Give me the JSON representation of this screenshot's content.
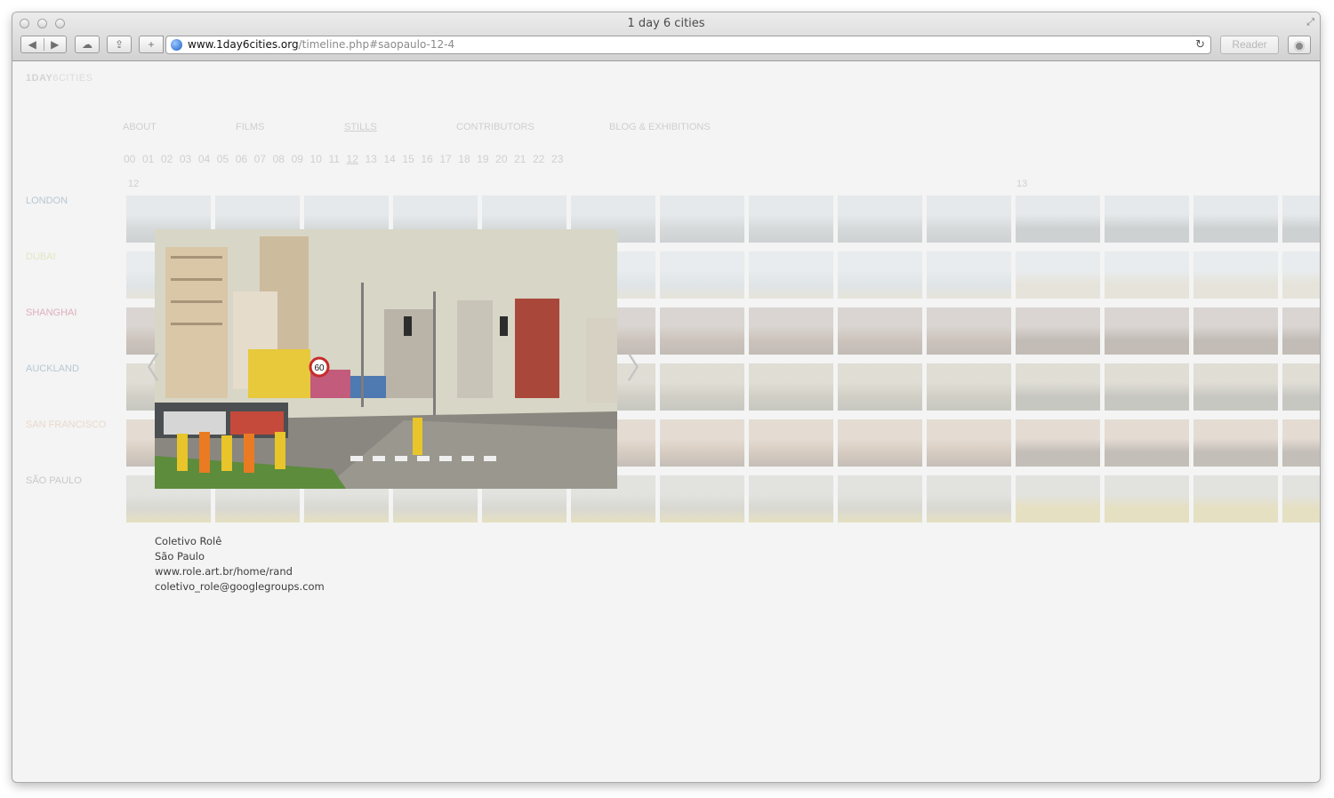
{
  "window": {
    "title": "1 day 6 cities"
  },
  "toolbar": {
    "url_host": "www.1day6cities.org",
    "url_path": "/timeline.php#saopaulo-12-4",
    "reader_label": "Reader"
  },
  "site": {
    "logo_bold": "1DAY",
    "logo_light": "6CITIES",
    "nav": [
      "ABOUT",
      "FILMS",
      "STILLS",
      "CONTRIBUTORS",
      "BLOG & EXHIBITIONS"
    ],
    "hours": [
      "00",
      "01",
      "02",
      "03",
      "04",
      "05",
      "06",
      "07",
      "08",
      "09",
      "10",
      "11",
      "12",
      "13",
      "14",
      "15",
      "16",
      "17",
      "18",
      "19",
      "20",
      "21",
      "22",
      "23"
    ],
    "active_hour": "12",
    "column_hours": [
      "12",
      "13"
    ],
    "cities": [
      {
        "name": "LONDON",
        "color": "#b9c6d6"
      },
      {
        "name": "DUBAI",
        "color": "#e4e6c5"
      },
      {
        "name": "SHANGHAI",
        "color": "#e0aebd"
      },
      {
        "name": "AUCKLAND",
        "color": "#b8c7d6"
      },
      {
        "name": "SAN FRANCISCO",
        "color": "#ead8cc"
      },
      {
        "name": "SÃO PAULO",
        "color": "#c8c8c8"
      }
    ]
  },
  "caption": {
    "name": "Coletivo Rolê",
    "city": "São Paulo",
    "website": "www.role.art.br/home/rand",
    "email": "coletivo_role@googlegroups.com"
  },
  "viewer": {
    "sign_text": "60"
  }
}
